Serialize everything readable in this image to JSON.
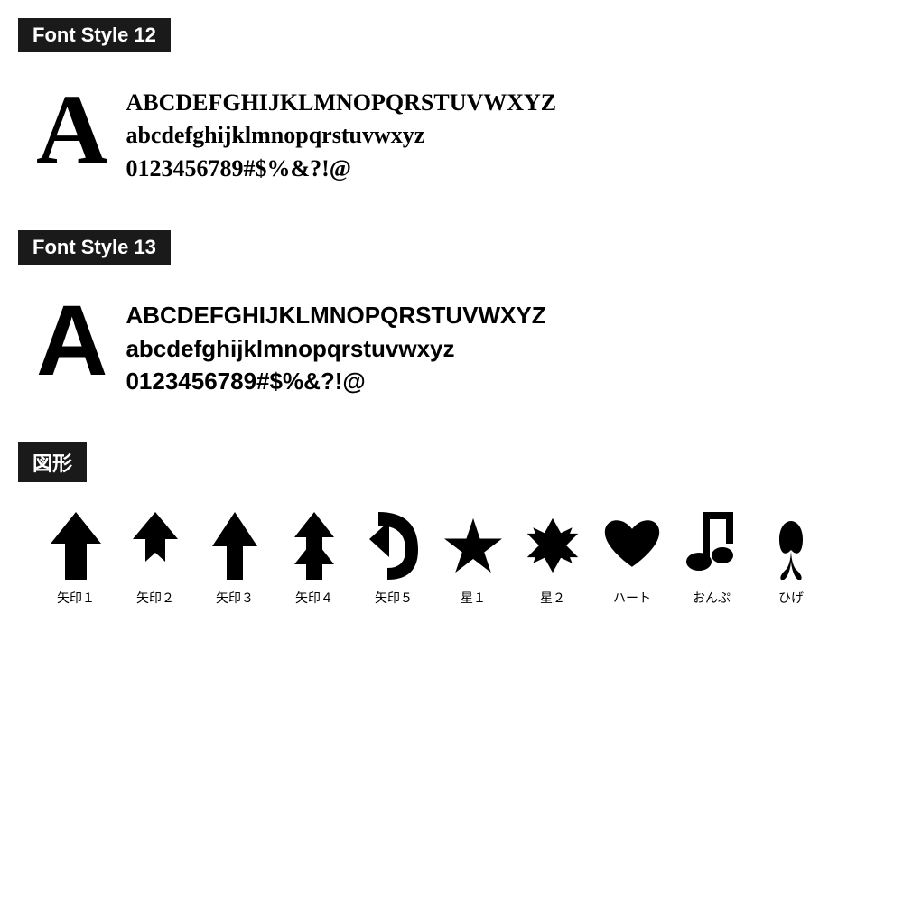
{
  "font_style_12": {
    "label": "Font Style 12",
    "big_letter": "A",
    "line1": "ABCDEFGHIJKLMNOPQRSTUVWXYZ",
    "line2": "abcdefghijklmnopqrstuvwxyz",
    "line3": "0123456789#$%&?!@"
  },
  "font_style_13": {
    "label": "Font Style 13",
    "big_letter": "A",
    "line1": "ABCDEFGHIJKLMNOPQRSTUVWXYZ",
    "line2": "abcdefghijklmnopqrstuvwxyz",
    "line3": "0123456789#$%&?!@"
  },
  "shapes": {
    "label": "図形",
    "items": [
      {
        "id": "arrow1",
        "label": "矢印１"
      },
      {
        "id": "arrow2",
        "label": "矢印２"
      },
      {
        "id": "arrow3",
        "label": "矢印３"
      },
      {
        "id": "arrow4",
        "label": "矢印４"
      },
      {
        "id": "arrow5",
        "label": "矢印５"
      },
      {
        "id": "star1",
        "label": "星１"
      },
      {
        "id": "star2",
        "label": "星２"
      },
      {
        "id": "heart",
        "label": "ハート"
      },
      {
        "id": "note",
        "label": "おんぷ"
      },
      {
        "id": "mustache",
        "label": "ひげ"
      }
    ]
  }
}
